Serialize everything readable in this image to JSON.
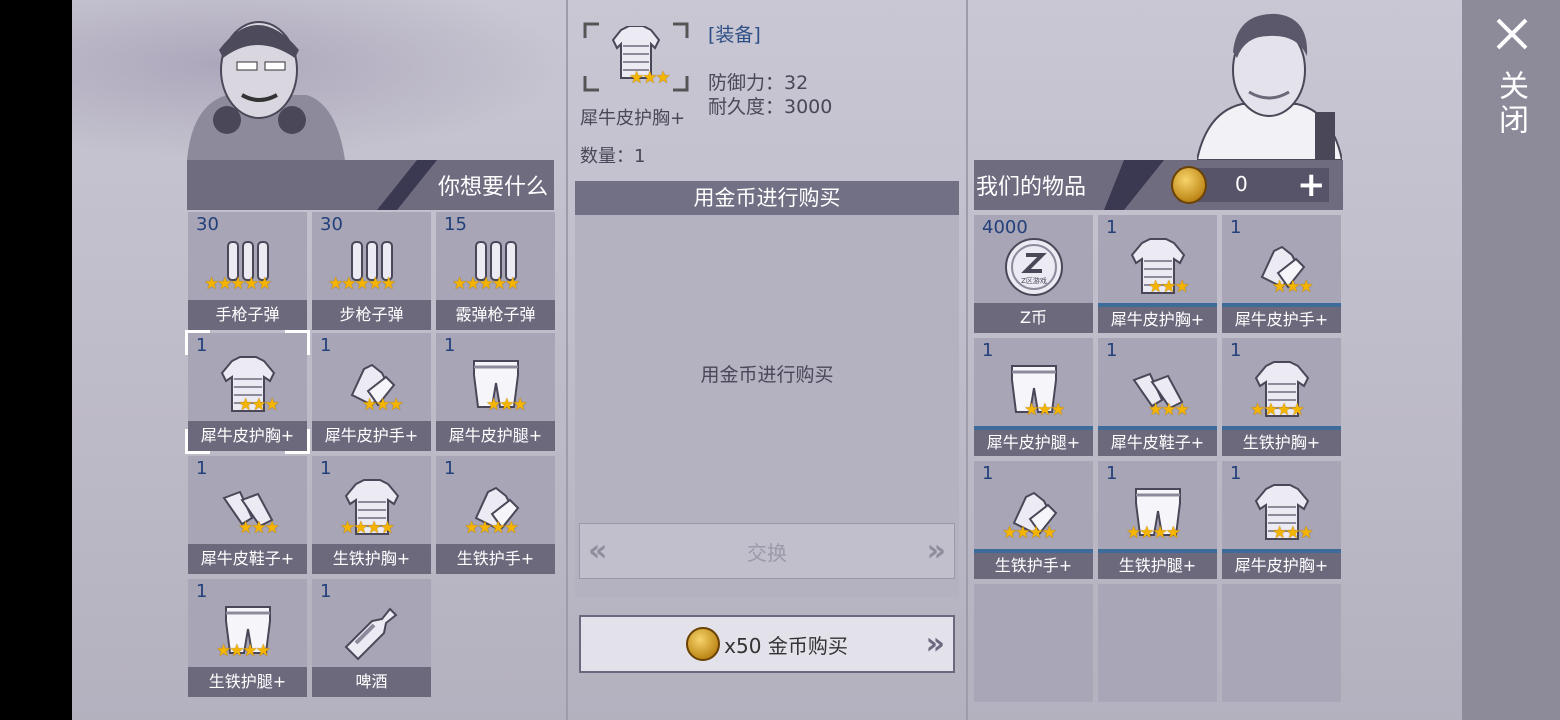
{
  "close": {
    "label": "关闭"
  },
  "left": {
    "header": "你想要什么",
    "items": [
      {
        "count": "30",
        "name": "手枪子弹",
        "icon": "pistol-ammo-icon",
        "stars": "★★★★★"
      },
      {
        "count": "30",
        "name": "步枪子弹",
        "icon": "rifle-ammo-icon",
        "stars": "★★★★★"
      },
      {
        "count": "15",
        "name": "霰弹枪子弹",
        "icon": "shotgun-ammo-icon",
        "stars": "★★★★★"
      },
      {
        "count": "1",
        "name": "犀牛皮护胸+",
        "icon": "chest-armor-icon",
        "stars": "★★★"
      },
      {
        "count": "1",
        "name": "犀牛皮护手+",
        "icon": "gloves-icon",
        "stars": "★★★"
      },
      {
        "count": "1",
        "name": "犀牛皮护腿+",
        "icon": "leg-armor-icon",
        "stars": "★★★"
      },
      {
        "count": "1",
        "name": "犀牛皮鞋子+",
        "icon": "shoes-icon",
        "stars": "★★★"
      },
      {
        "count": "1",
        "name": "生铁护胸+",
        "icon": "iron-chest-icon",
        "stars": "★★★★"
      },
      {
        "count": "1",
        "name": "生铁护手+",
        "icon": "iron-gloves-icon",
        "stars": "★★★★"
      },
      {
        "count": "1",
        "name": "生铁护腿+",
        "icon": "iron-leg-icon",
        "stars": "★★★★"
      },
      {
        "count": "1",
        "name": "啤酒",
        "icon": "beer-bottle-icon",
        "stars": ""
      }
    ]
  },
  "detail": {
    "category": "[装备]",
    "item_name": "犀牛皮护胸+",
    "stars": "★★★",
    "defense": "防御力：32",
    "durability": "耐久度：3000",
    "quantity": "数量：1",
    "buy_bar": "用金币进行购买",
    "buy_message": "用金币进行购买",
    "exchange_label": "交换",
    "buy_button_label": "x50 金币购买"
  },
  "right": {
    "header": "我们的物品",
    "coins": "0",
    "items": [
      {
        "count": "4000",
        "name": "Z币",
        "icon": "z-coin-icon",
        "stars": ""
      },
      {
        "count": "1",
        "name": "犀牛皮护胸+",
        "icon": "chest-armor-icon",
        "stars": "★★★"
      },
      {
        "count": "1",
        "name": "犀牛皮护手+",
        "icon": "gloves-icon",
        "stars": "★★★"
      },
      {
        "count": "1",
        "name": "犀牛皮护腿+",
        "icon": "leg-armor-icon",
        "stars": "★★★"
      },
      {
        "count": "1",
        "name": "犀牛皮鞋子+",
        "icon": "shoes-icon",
        "stars": "★★★"
      },
      {
        "count": "1",
        "name": "生铁护胸+",
        "icon": "iron-chest-icon",
        "stars": "★★★★"
      },
      {
        "count": "1",
        "name": "生铁护手+",
        "icon": "iron-gloves-icon",
        "stars": "★★★★"
      },
      {
        "count": "1",
        "name": "生铁护腿+",
        "icon": "iron-leg-icon",
        "stars": "★★★★"
      },
      {
        "count": "1",
        "name": "犀牛皮护胸+",
        "icon": "chest-armor-icon",
        "stars": "★★★"
      }
    ],
    "zcoin_text": "Z区游戏"
  },
  "colors": {
    "name_bar": "#6c697d",
    "count": "#23407a",
    "star": "#f4b400",
    "selected_underline": "#3d6b9a"
  }
}
